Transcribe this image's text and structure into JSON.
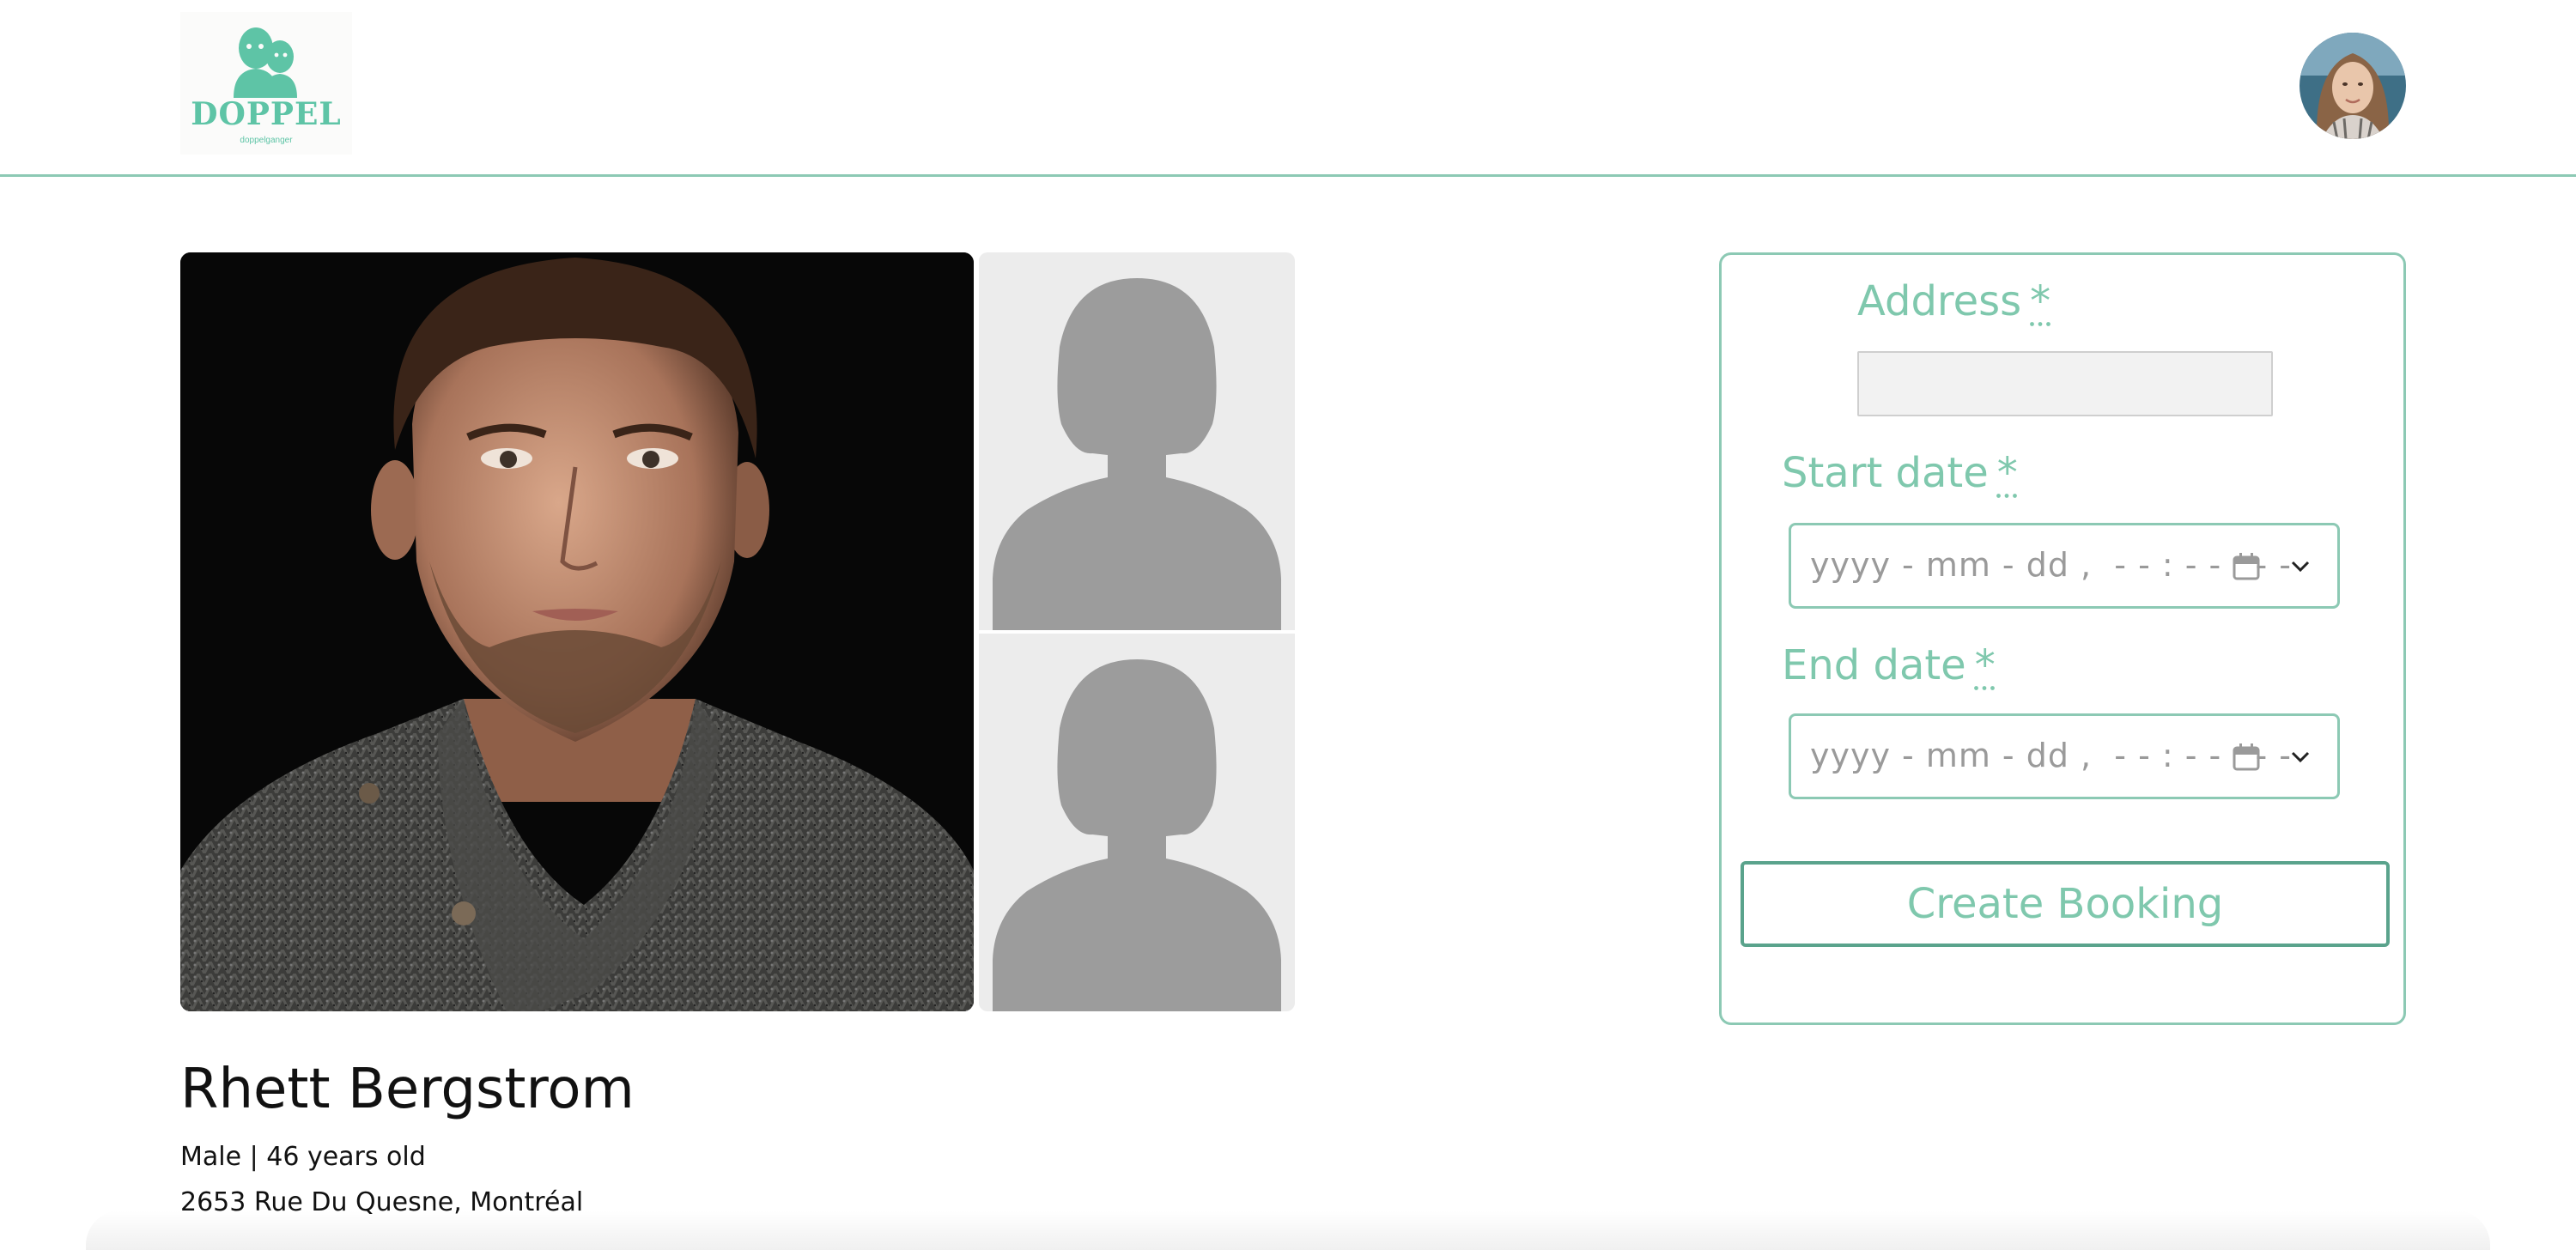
{
  "header": {
    "logo": {
      "title": "DOPPEL",
      "subtitle": "doppelganger"
    },
    "avatar_icon": "user-avatar"
  },
  "gallery": {
    "main_photo": "profile-photo",
    "thumbnails": [
      "placeholder-silhouette",
      "placeholder-silhouette"
    ]
  },
  "profile": {
    "name": "Rhett Bergstrom",
    "details": "Male | 46 years old",
    "address": "2653 Rue Du Quesne, Montréal"
  },
  "booking": {
    "address_label": "Address",
    "address_value": "",
    "start_label": "Start date",
    "start_placeholder": "yyyy - mm - dd ,  - - : - -   - -",
    "end_label": "End date",
    "end_placeholder": "yyyy - mm - dd ,  - - : - -   - -",
    "required_mark": "*",
    "submit_label": "Create Booking"
  },
  "colors": {
    "accent": "#7fc8ad",
    "border": "#8cc9b4",
    "button_border": "#5aa38c"
  }
}
